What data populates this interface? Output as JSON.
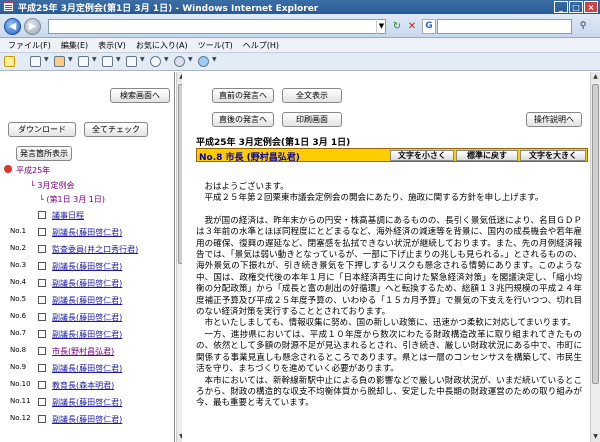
{
  "window": {
    "title": "平成25年 3月定例会(第1日 3月 1日) - Windows Internet Explorer"
  },
  "browser": {
    "back_label": "◀",
    "forward_label": "▶",
    "address_value": "",
    "search_value": "",
    "menu": [
      "ファイル(F)",
      "編集(E)",
      "表示(V)",
      "お気に入り(A)",
      "ツール(T)",
      "ヘルプ(H)"
    ]
  },
  "left": {
    "search_button": "検索画面へ",
    "download_button": "ダウンロード",
    "check_all_button": "全てチェック",
    "speaker_list_button": "発言箇所表示",
    "tree_root": "平成25年",
    "tree_session": "3月定例会",
    "tree_day": "(第1日 3月 1日)",
    "agenda_label": "議事日程",
    "items": [
      {
        "no": "No.1",
        "label": "副議長(藤田啓仁君)"
      },
      {
        "no": "No.2",
        "label": "監査委員(井之口秀行君)"
      },
      {
        "no": "No.3",
        "label": "副議長(藤田啓仁君)"
      },
      {
        "no": "No.4",
        "label": "副議長(藤田啓仁君)"
      },
      {
        "no": "No.5",
        "label": "副議長(藤田啓仁君)"
      },
      {
        "no": "No.6",
        "label": "副議長(藤田啓仁君)"
      },
      {
        "no": "No.7",
        "label": "副議長(藤田啓仁君)"
      },
      {
        "no": "No.8",
        "label": "市長(野村昌弘君)"
      },
      {
        "no": "No.9",
        "label": "副議長(藤田啓仁君)"
      },
      {
        "no": "No.10",
        "label": "教育長(森本明君)"
      },
      {
        "no": "No.11",
        "label": "副議長(藤田啓仁君)"
      },
      {
        "no": "No.12",
        "label": "副議長(藤田啓仁君)"
      }
    ]
  },
  "right": {
    "prev_button": "直前の発言へ",
    "show_all_button": "全文表示",
    "next_button": "直後の発言へ",
    "print_button": "印刷画面",
    "help_button": "操作説明へ",
    "meeting_title": "平成25年 3月定例会(第1日 3月 1日)",
    "speaker": "No.8 市長 (野村昌弘君)",
    "smaller_button": "文字を小さく",
    "reset_button": "標準に戻す",
    "larger_button": "文字を大きく",
    "paragraphs": [
      "おはようございます。",
      "平成２５年第２回栗東市議会定例会の開会にあたり、施政に関する方針を申し上げます。",
      "我が国の経済は、昨年末からの円安・株高基調にあるものの、長引く景気低迷により、名目ＧＤＰは３年前の水準とほぼ同程度にとどまるなど、海外経済の減速等を背景に、国内の成長機会や若年雇用の確保、復興の遅延など、閉塞感を払拭できない状況が継続しております。また、先の月例経済報告では、「景気は弱い動きとなっているが、一部に下げ止まりの兆しも見られる。」とされるものの、海外景気の下振れが、引き続き景気を下押しするリスクも懸念される情勢にあります。このような中、国は、政権交代後の本年１月に「日本経済再生に向けた緊急経済対策」を閣議決定し、「縮小均衡の分配政策」から「成長と富の創出の好循環」へと転換するため、総額１３兆円規模の平成２４年度補正予算及び平成２５年度予算の、いわゆる「１５カ月予算」で景気の下支えを行いつつ、切れ目のない経済対策を実行することとされております。",
      "市といたしましても、情報収集に努め、国の新しい政策に、迅速かつ柔軟に対応してまいります。",
      "一方、進捗県においては、平成１０年度から数次にわたる財政構造改革に取り組まれてきたものの、依然として多額の財源不足が見込まれるとされ、引き続き、厳しい財政状況にある中で、市町に関係する事業見直しも懸念されるところであります。県とは一層のコンセンサスを構築して、市民生活を守り、まちづくりを進めていく必要があります。",
      "本市においては、新幹線新駅中止による負の影響などで厳しい財政状況が、いまだ続いているところから、財政の構造的な収支不均衡体質から脱却し、安定した中長期の財政運営のための取り組みが今、最も重要と考えています。"
    ]
  }
}
